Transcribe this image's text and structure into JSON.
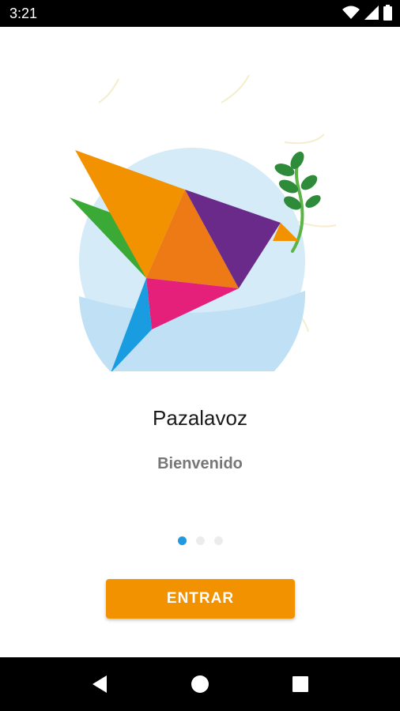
{
  "status_bar": {
    "time": "3:21",
    "icons": [
      "wifi-icon",
      "signal-icon",
      "battery-icon"
    ]
  },
  "splash": {
    "app_name": "Pazalavoz",
    "welcome_text": "Bienvenido",
    "pager": {
      "total": 3,
      "active_index": 0
    },
    "enter_button_label": "ENTRAR"
  },
  "nav_bar": {
    "buttons": [
      "back-icon",
      "home-icon",
      "recents-icon"
    ]
  },
  "colors": {
    "accent": "#f39200",
    "dot_active": "#1e9be0",
    "dot_inactive": "#ececec",
    "title": "#1a1a1a",
    "subtitle": "#777777"
  }
}
